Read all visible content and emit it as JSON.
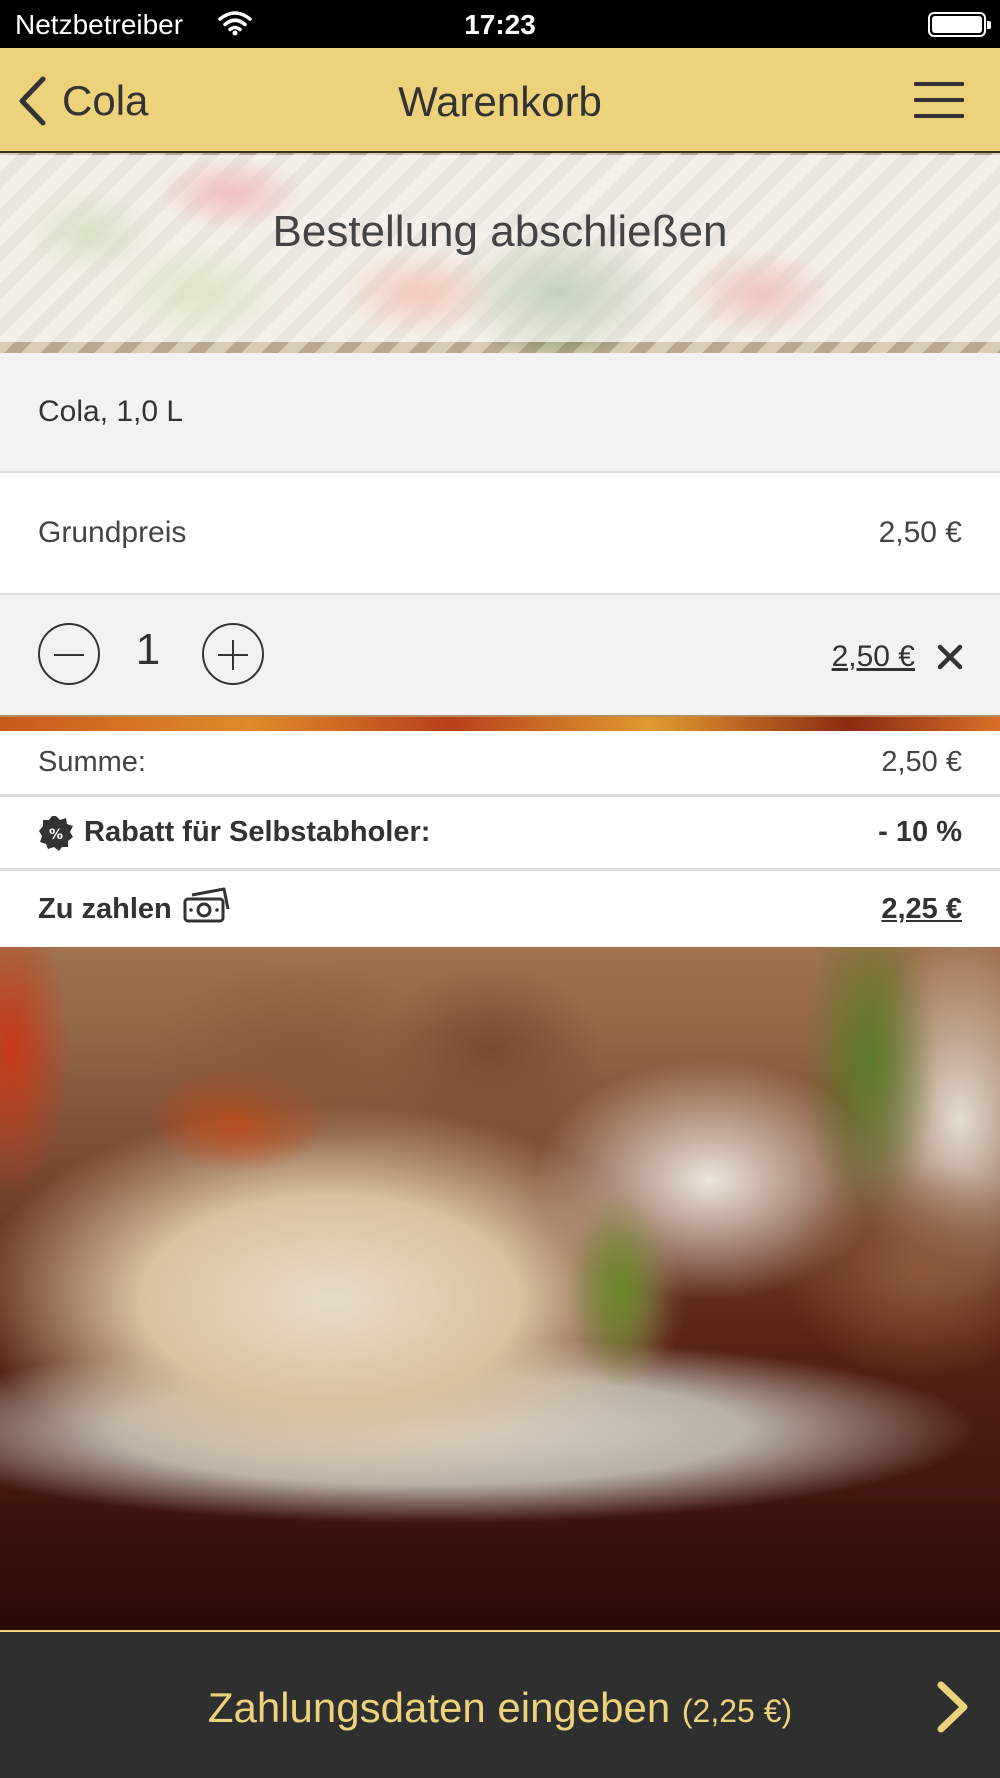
{
  "status_bar": {
    "carrier": "Netzbetreiber",
    "time": "17:23"
  },
  "nav": {
    "back_label": "Cola",
    "title": "Warenkorb"
  },
  "banner": {
    "title": "Bestellung abschließen"
  },
  "cart": {
    "item_name": "Cola, 1,0 L",
    "base_price_label": "Grundpreis",
    "base_price": "2,50 €",
    "quantity": "1",
    "line_total": "2,50 €"
  },
  "totals": {
    "sum_label": "Summe:",
    "sum_value": "2,50 €",
    "discount_badge": "%",
    "discount_label": "Rabatt für Selbstabholer:",
    "discount_value": "- 10 %",
    "pay_label": "Zu zahlen",
    "pay_value": "2,25 €"
  },
  "cta": {
    "label": "Zahlungsdaten eingeben",
    "amount": "(2,25 €)"
  },
  "colors": {
    "accent": "#ecd37b",
    "cta_background": "#2f2f2f"
  },
  "icons": [
    "wifi-icon",
    "battery-icon",
    "chevron-left-icon",
    "hamburger-menu-icon",
    "minus-icon",
    "plus-icon",
    "close-icon",
    "percent-badge-icon",
    "cash-icon",
    "chevron-right-icon"
  ]
}
